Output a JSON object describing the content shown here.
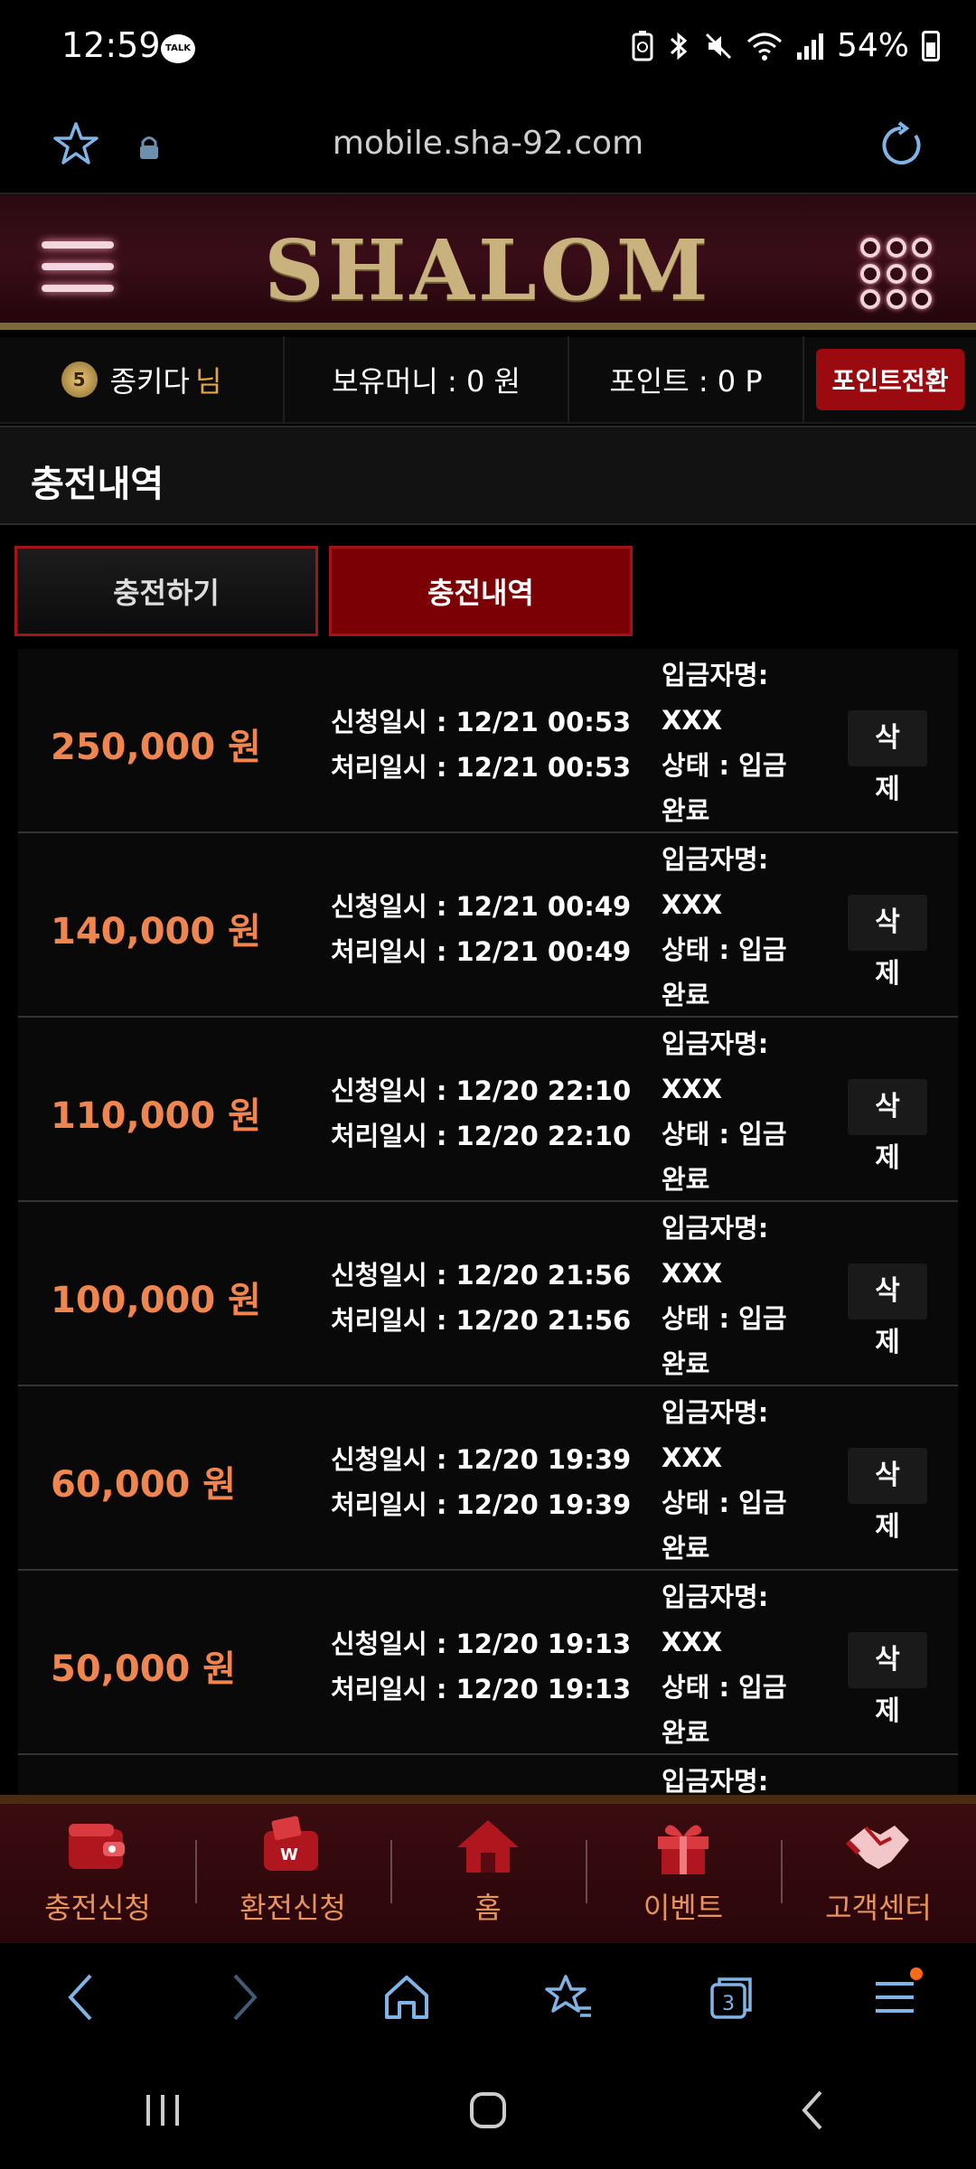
{
  "status_bar": {
    "time": "12:59",
    "talk_badge": "TALK",
    "battery_pct": "54%"
  },
  "url_bar": {
    "url": "mobile.sha-92.com"
  },
  "header": {
    "logo": "SHALOM"
  },
  "user_bar": {
    "level": "5",
    "username": "종키다",
    "honorific": "님",
    "money": "보유머니 : 0 원",
    "points": "포인트 : 0 P",
    "convert_button": "포인트전환"
  },
  "section": {
    "title": "충전내역"
  },
  "tabs": [
    {
      "label": "충전하기",
      "active": false
    },
    {
      "label": "충전내역",
      "active": true
    }
  ],
  "records": [
    {
      "amount": "250,000 원",
      "requested": "신청일시 : 12/21 00:53",
      "processed": "처리일시 : 12/21 00:53",
      "depositor_label": "입금자명:",
      "depositor": "XXX",
      "status": "상태 : 입금",
      "status2": "완료",
      "delete_a": "삭",
      "delete_b": "제"
    },
    {
      "amount": "140,000 원",
      "requested": "신청일시 : 12/21 00:49",
      "processed": "처리일시 : 12/21 00:49",
      "depositor_label": "입금자명:",
      "depositor": "XXX",
      "status": "상태 : 입금",
      "status2": "완료",
      "delete_a": "삭",
      "delete_b": "제"
    },
    {
      "amount": "110,000 원",
      "requested": "신청일시 : 12/20 22:10",
      "processed": "처리일시 : 12/20 22:10",
      "depositor_label": "입금자명:",
      "depositor": "XXX",
      "status": "상태 : 입금",
      "status2": "완료",
      "delete_a": "삭",
      "delete_b": "제"
    },
    {
      "amount": "100,000 원",
      "requested": "신청일시 : 12/20 21:56",
      "processed": "처리일시 : 12/20 21:56",
      "depositor_label": "입금자명:",
      "depositor": "XXX",
      "status": "상태 : 입금",
      "status2": "완료",
      "delete_a": "삭",
      "delete_b": "제"
    },
    {
      "amount": "60,000 원",
      "requested": "신청일시 : 12/20 19:39",
      "processed": "처리일시 : 12/20 19:39",
      "depositor_label": "입금자명:",
      "depositor": "XXX",
      "status": "상태 : 입금",
      "status2": "완료",
      "delete_a": "삭",
      "delete_b": "제"
    },
    {
      "amount": "50,000 원",
      "requested": "신청일시 : 12/20 19:13",
      "processed": "처리일시 : 12/20 19:13",
      "depositor_label": "입금자명:",
      "depositor": "XXX",
      "status": "상태 : 입금",
      "status2": "완료",
      "delete_a": "삭",
      "delete_b": "제"
    }
  ],
  "partial_record": {
    "depositor_label": "입금자명:"
  },
  "site_nav": [
    {
      "label": "충전신청",
      "icon": "wallet-icon"
    },
    {
      "label": "환전신청",
      "icon": "exchange-wallet-icon"
    },
    {
      "label": "홈",
      "icon": "home-icon"
    },
    {
      "label": "이벤트",
      "icon": "gift-icon"
    },
    {
      "label": "고객센터",
      "icon": "handshake-icon"
    }
  ],
  "browser_toolbar": {
    "tab_count": "3"
  },
  "colors": {
    "amount": "#f0864e",
    "accent_red": "#9b0a0f",
    "nav_label": "#e7935a",
    "gold": "#c9b27e"
  }
}
